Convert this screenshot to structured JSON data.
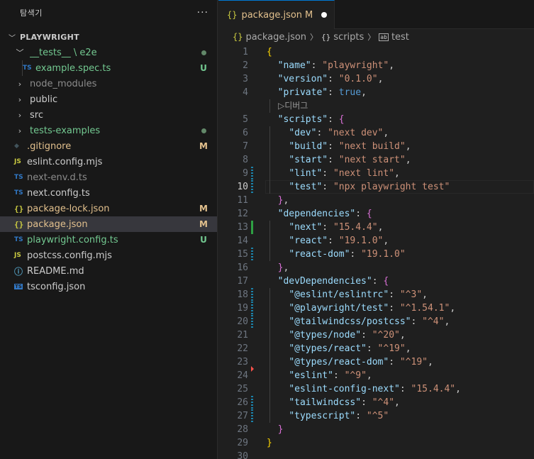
{
  "sidebar": {
    "title": "탐색기",
    "more": "···",
    "project": "PLAYWRIGHT",
    "items": [
      {
        "label": "__tests__ \\ e2e",
        "type": "folder-open",
        "color": "#73c991",
        "status": "dot",
        "indent": 0
      },
      {
        "label": "example.spec.ts",
        "type": "ts",
        "color": "#73c991",
        "status": "U",
        "indent": 1
      },
      {
        "label": "node_modules",
        "type": "folder",
        "color": "#8c8c8c",
        "status": "",
        "indent": 0
      },
      {
        "label": "public",
        "type": "folder",
        "color": "#cccccc",
        "status": "",
        "indent": 0
      },
      {
        "label": "src",
        "type": "folder",
        "color": "#cccccc",
        "status": "",
        "indent": 0
      },
      {
        "label": "tests-examples",
        "type": "folder",
        "color": "#73c991",
        "status": "dot",
        "indent": 0
      },
      {
        "label": ".gitignore",
        "type": "git",
        "color": "#e2c08d",
        "status": "M",
        "indent": 0
      },
      {
        "label": "eslint.config.mjs",
        "type": "js",
        "color": "#cccccc",
        "status": "",
        "indent": 0
      },
      {
        "label": "next-env.d.ts",
        "type": "ts",
        "color": "#8c8c8c",
        "status": "",
        "indent": 0
      },
      {
        "label": "next.config.ts",
        "type": "ts",
        "color": "#cccccc",
        "status": "",
        "indent": 0
      },
      {
        "label": "package-lock.json",
        "type": "json",
        "color": "#e2c08d",
        "status": "M",
        "indent": 0
      },
      {
        "label": "package.json",
        "type": "json",
        "color": "#e2c08d",
        "status": "M",
        "indent": 0,
        "selected": true
      },
      {
        "label": "playwright.config.ts",
        "type": "ts",
        "color": "#73c991",
        "status": "U",
        "indent": 0
      },
      {
        "label": "postcss.config.mjs",
        "type": "js",
        "color": "#cccccc",
        "status": "",
        "indent": 0
      },
      {
        "label": "README.md",
        "type": "info",
        "color": "#cccccc",
        "status": "",
        "indent": 0
      },
      {
        "label": "tsconfig.json",
        "type": "tsconfig",
        "color": "#cccccc",
        "status": "",
        "indent": 0
      }
    ]
  },
  "tab": {
    "icon": "{}",
    "label": "package.json",
    "status": "M"
  },
  "breadcrumbs": {
    "file": "package.json",
    "obj": "scripts",
    "key": "test",
    "obj_icon": "{}"
  },
  "codelens": "▷디버그",
  "current_line": 10,
  "colors": {
    "modified": "#e2c08d",
    "untracked": "#73c991",
    "accent": "#0078d4"
  },
  "lines": [
    {
      "n": "1",
      "tokens": [
        [
          "b1",
          "{"
        ]
      ],
      "gutter": ""
    },
    {
      "n": "2",
      "tokens": [
        [
          "p",
          "  "
        ],
        [
          "k",
          "\"name\""
        ],
        [
          "p",
          ": "
        ],
        [
          "s",
          "\"playwright\""
        ],
        [
          "p",
          ","
        ]
      ],
      "gutter": ""
    },
    {
      "n": "3",
      "tokens": [
        [
          "p",
          "  "
        ],
        [
          "k",
          "\"version\""
        ],
        [
          "p",
          ": "
        ],
        [
          "s",
          "\"0.1.0\""
        ],
        [
          "p",
          ","
        ]
      ],
      "gutter": ""
    },
    {
      "n": "4",
      "tokens": [
        [
          "p",
          "  "
        ],
        [
          "k",
          "\"private\""
        ],
        [
          "p",
          ": "
        ],
        [
          "bool",
          "true"
        ],
        [
          "p",
          ","
        ]
      ],
      "gutter": ""
    },
    {
      "n": "",
      "tokens": [],
      "gutter": "",
      "lens": true
    },
    {
      "n": "5",
      "tokens": [
        [
          "p",
          "  "
        ],
        [
          "k",
          "\"scripts\""
        ],
        [
          "p",
          ": "
        ],
        [
          "b2",
          "{"
        ]
      ],
      "gutter": ""
    },
    {
      "n": "6",
      "tokens": [
        [
          "p",
          "    "
        ],
        [
          "k",
          "\"dev\""
        ],
        [
          "p",
          ": "
        ],
        [
          "s",
          "\"next dev\""
        ],
        [
          "p",
          ","
        ]
      ],
      "gutter": ""
    },
    {
      "n": "7",
      "tokens": [
        [
          "p",
          "    "
        ],
        [
          "k",
          "\"build\""
        ],
        [
          "p",
          ": "
        ],
        [
          "s",
          "\"next build\""
        ],
        [
          "p",
          ","
        ]
      ],
      "gutter": ""
    },
    {
      "n": "8",
      "tokens": [
        [
          "p",
          "    "
        ],
        [
          "k",
          "\"start\""
        ],
        [
          "p",
          ": "
        ],
        [
          "s",
          "\"next start\""
        ],
        [
          "p",
          ","
        ]
      ],
      "gutter": ""
    },
    {
      "n": "9",
      "tokens": [
        [
          "p",
          "    "
        ],
        [
          "k",
          "\"lint\""
        ],
        [
          "p",
          ": "
        ],
        [
          "s",
          "\"next lint\""
        ],
        [
          "p",
          ","
        ]
      ],
      "gutter": "mod"
    },
    {
      "n": "10",
      "tokens": [
        [
          "p",
          "    "
        ],
        [
          "k",
          "\"test\""
        ],
        [
          "p",
          ": "
        ],
        [
          "s",
          "\"npx playwright test\""
        ]
      ],
      "gutter": "mod"
    },
    {
      "n": "11",
      "tokens": [
        [
          "p",
          "  "
        ],
        [
          "b2",
          "}"
        ],
        [
          "p",
          ","
        ]
      ],
      "gutter": ""
    },
    {
      "n": "12",
      "tokens": [
        [
          "p",
          "  "
        ],
        [
          "k",
          "\"dependencies\""
        ],
        [
          "p",
          ": "
        ],
        [
          "b2",
          "{"
        ]
      ],
      "gutter": ""
    },
    {
      "n": "13",
      "tokens": [
        [
          "p",
          "    "
        ],
        [
          "k",
          "\"next\""
        ],
        [
          "p",
          ": "
        ],
        [
          "s",
          "\"15.4.4\""
        ],
        [
          "p",
          ","
        ]
      ],
      "gutter": "add"
    },
    {
      "n": "14",
      "tokens": [
        [
          "p",
          "    "
        ],
        [
          "k",
          "\"react\""
        ],
        [
          "p",
          ": "
        ],
        [
          "s",
          "\"19.1.0\""
        ],
        [
          "p",
          ","
        ]
      ],
      "gutter": ""
    },
    {
      "n": "15",
      "tokens": [
        [
          "p",
          "    "
        ],
        [
          "k",
          "\"react-dom\""
        ],
        [
          "p",
          ": "
        ],
        [
          "s",
          "\"19.1.0\""
        ]
      ],
      "gutter": "mod"
    },
    {
      "n": "16",
      "tokens": [
        [
          "p",
          "  "
        ],
        [
          "b2",
          "}"
        ],
        [
          "p",
          ","
        ]
      ],
      "gutter": ""
    },
    {
      "n": "17",
      "tokens": [
        [
          "p",
          "  "
        ],
        [
          "k",
          "\"devDependencies\""
        ],
        [
          "p",
          ": "
        ],
        [
          "b2",
          "{"
        ]
      ],
      "gutter": ""
    },
    {
      "n": "18",
      "tokens": [
        [
          "p",
          "    "
        ],
        [
          "k",
          "\"@eslint/eslintrc\""
        ],
        [
          "p",
          ": "
        ],
        [
          "s",
          "\"^3\""
        ],
        [
          "p",
          ","
        ]
      ],
      "gutter": "mod"
    },
    {
      "n": "19",
      "tokens": [
        [
          "p",
          "    "
        ],
        [
          "k",
          "\"@playwright/test\""
        ],
        [
          "p",
          ": "
        ],
        [
          "s",
          "\"^1.54.1\""
        ],
        [
          "p",
          ","
        ]
      ],
      "gutter": "mod"
    },
    {
      "n": "20",
      "tokens": [
        [
          "p",
          "    "
        ],
        [
          "k",
          "\"@tailwindcss/postcss\""
        ],
        [
          "p",
          ": "
        ],
        [
          "s",
          "\"^4\""
        ],
        [
          "p",
          ","
        ]
      ],
      "gutter": "mod"
    },
    {
      "n": "21",
      "tokens": [
        [
          "p",
          "    "
        ],
        [
          "k",
          "\"@types/node\""
        ],
        [
          "p",
          ": "
        ],
        [
          "s",
          "\"^20\""
        ],
        [
          "p",
          ","
        ]
      ],
      "gutter": ""
    },
    {
      "n": "22",
      "tokens": [
        [
          "p",
          "    "
        ],
        [
          "k",
          "\"@types/react\""
        ],
        [
          "p",
          ": "
        ],
        [
          "s",
          "\"^19\""
        ],
        [
          "p",
          ","
        ]
      ],
      "gutter": ""
    },
    {
      "n": "23",
      "tokens": [
        [
          "p",
          "    "
        ],
        [
          "k",
          "\"@types/react-dom\""
        ],
        [
          "p",
          ": "
        ],
        [
          "s",
          "\"^19\""
        ],
        [
          "p",
          ","
        ]
      ],
      "gutter": ""
    },
    {
      "n": "24",
      "tokens": [
        [
          "p",
          "    "
        ],
        [
          "k",
          "\"eslint\""
        ],
        [
          "p",
          ": "
        ],
        [
          "s",
          "\"^9\""
        ],
        [
          "p",
          ","
        ]
      ],
      "gutter": "del"
    },
    {
      "n": "25",
      "tokens": [
        [
          "p",
          "    "
        ],
        [
          "k",
          "\"eslint-config-next\""
        ],
        [
          "p",
          ": "
        ],
        [
          "s",
          "\"15.4.4\""
        ],
        [
          "p",
          ","
        ]
      ],
      "gutter": ""
    },
    {
      "n": "26",
      "tokens": [
        [
          "p",
          "    "
        ],
        [
          "k",
          "\"tailwindcss\""
        ],
        [
          "p",
          ": "
        ],
        [
          "s",
          "\"^4\""
        ],
        [
          "p",
          ","
        ]
      ],
      "gutter": "mod"
    },
    {
      "n": "27",
      "tokens": [
        [
          "p",
          "    "
        ],
        [
          "k",
          "\"typescript\""
        ],
        [
          "p",
          ": "
        ],
        [
          "s",
          "\"^5\""
        ]
      ],
      "gutter": "mod"
    },
    {
      "n": "28",
      "tokens": [
        [
          "p",
          "  "
        ],
        [
          "b2",
          "}"
        ]
      ],
      "gutter": ""
    },
    {
      "n": "29",
      "tokens": [
        [
          "b1",
          "}"
        ]
      ],
      "gutter": ""
    },
    {
      "n": "30",
      "tokens": [],
      "gutter": ""
    }
  ]
}
